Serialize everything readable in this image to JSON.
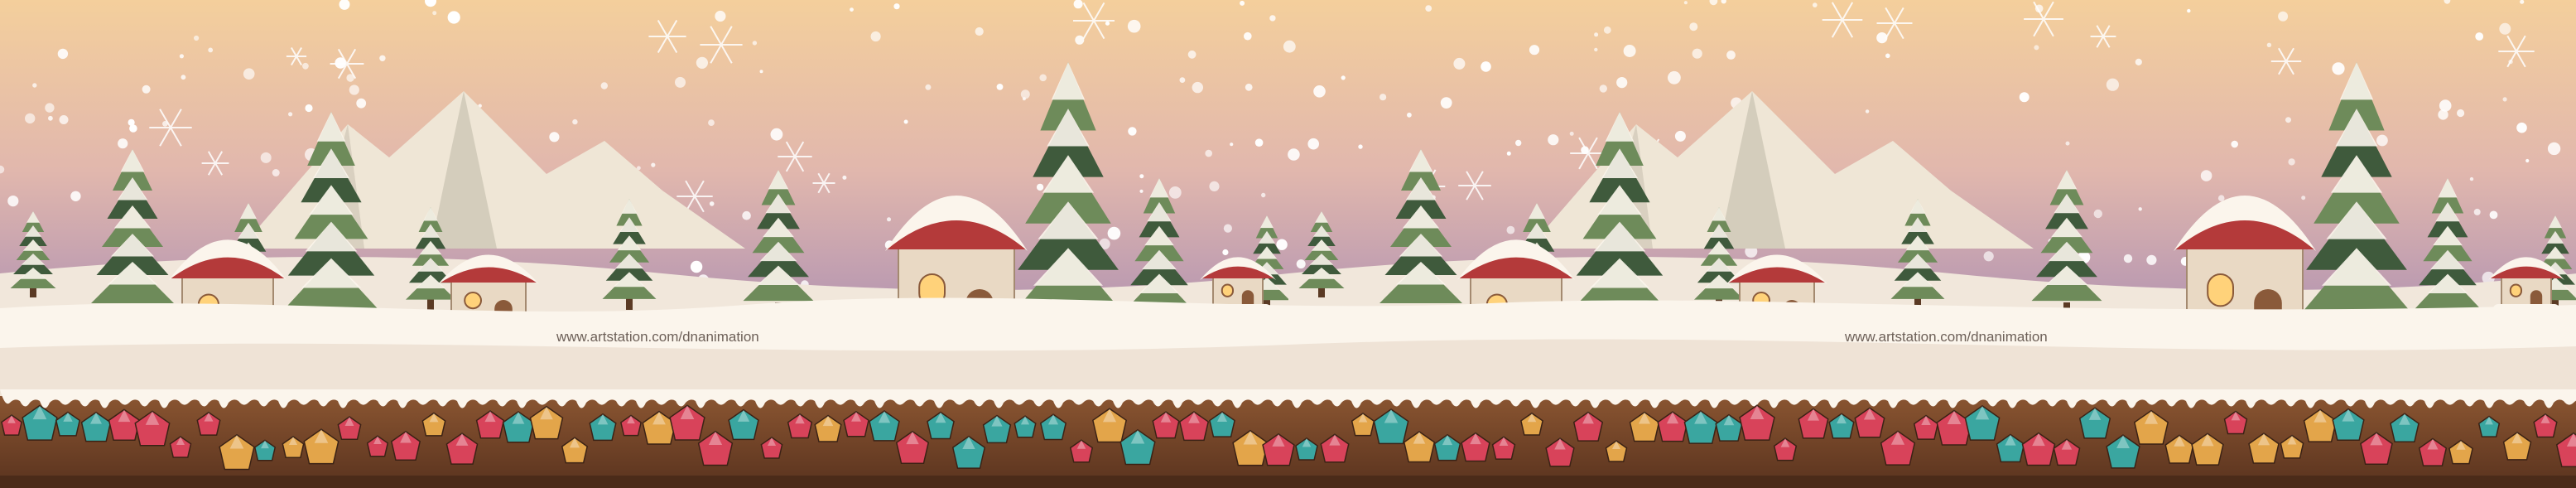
{
  "scene": {
    "type": "side-scrolling winter village level background",
    "tile_count": 2,
    "watermark": "www.artstation.com/dnanimation",
    "layers": [
      "sky gradient",
      "snowfall",
      "snowy mountains",
      "pine forest",
      "cottages",
      "snow ground",
      "gem soil strip"
    ],
    "colors": {
      "sky_top": "#f4cf9c",
      "sky_mid": "#c7a3b4",
      "sky_low": "#8e7c9c",
      "mountain": "#efe6d6",
      "mountain_shadow": "#c9c2b0",
      "pine": "#3f5a3c",
      "pine_light": "#6e8b5a",
      "snow": "#fbf5ec",
      "snow_shade": "#e6d8c9",
      "roof_red": "#b43a3a",
      "window_glow": "#ffd27a",
      "soil": "#7a4a2b",
      "gem_red": "#d8435a",
      "gem_teal": "#3aa6a0",
      "gem_gold": "#e3a54a"
    }
  }
}
